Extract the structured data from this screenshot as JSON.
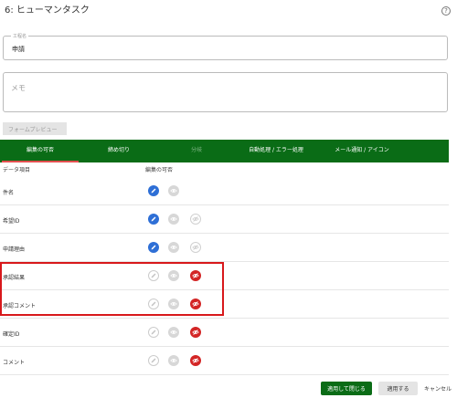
{
  "header": {
    "title": "6: ヒューマンタスク",
    "help_symbol": "?"
  },
  "name_field": {
    "label": "工程名",
    "value": "申請"
  },
  "memo_field": {
    "placeholder": "メモ"
  },
  "preview_button": {
    "label": "フォームプレビュー"
  },
  "tabs": [
    {
      "label": "編集の可否",
      "state": "active"
    },
    {
      "label": "締め切り",
      "state": "normal"
    },
    {
      "label": "分岐",
      "state": "disabled"
    },
    {
      "label": "自動処理 / エラー処理",
      "state": "normal"
    },
    {
      "label": "メール通知 / アイコン",
      "state": "normal"
    }
  ],
  "columns": {
    "item": "データ項目",
    "editable": "編集の可否"
  },
  "rows": [
    {
      "label": "件名",
      "mode": "edit"
    },
    {
      "label": "希望ID",
      "mode": "edit"
    },
    {
      "label": "申請理由",
      "mode": "edit"
    },
    {
      "label": "承認結果",
      "mode": "hidden"
    },
    {
      "label": "承認コメント",
      "mode": "hidden"
    },
    {
      "label": "確定ID",
      "mode": "hidden"
    },
    {
      "label": "コメント",
      "mode": "hidden"
    }
  ],
  "footer": {
    "apply_close": "適用して閉じる",
    "apply": "適用する",
    "cancel": "キャンセル"
  },
  "colors": {
    "brand_green": "#0a6c16",
    "edit_blue": "#2e6fd6",
    "hidden_red": "#d32525",
    "highlight_red": "#d8181b"
  }
}
